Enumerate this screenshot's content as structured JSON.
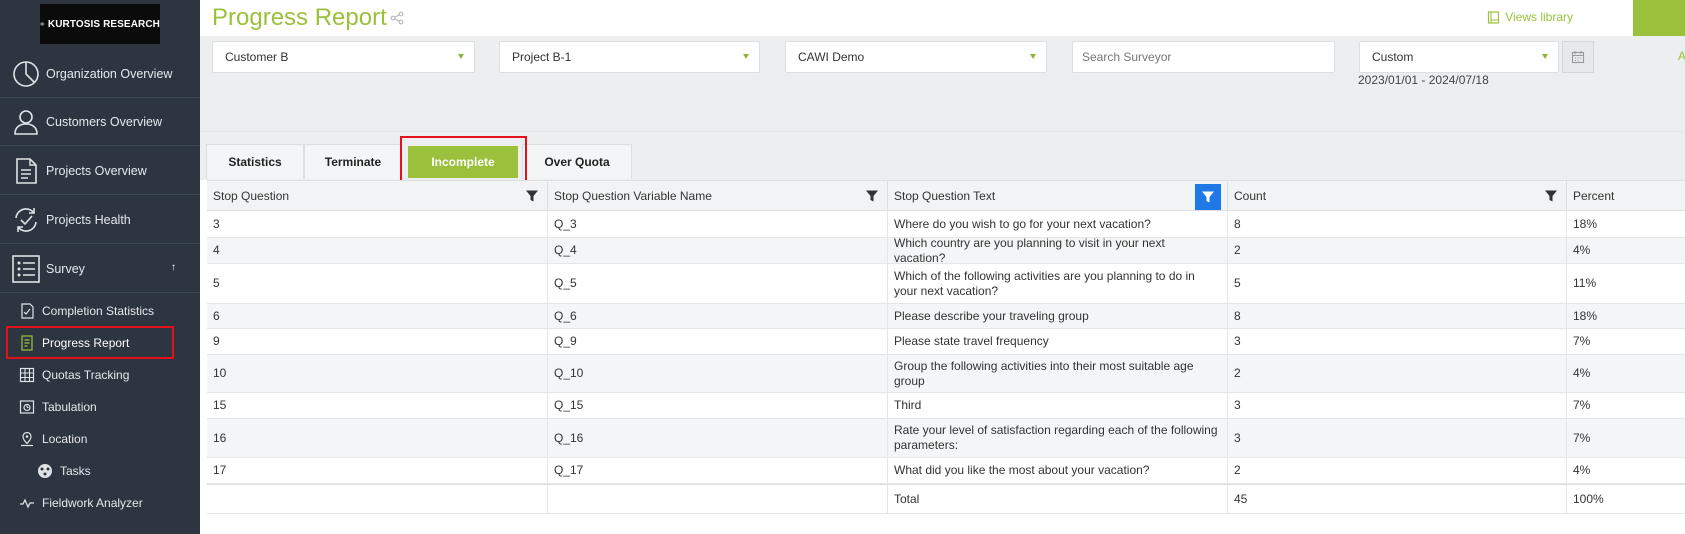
{
  "brand": {
    "logo_text": "KURTOSIS RESEARCH",
    "accent_color": "#9bc13c",
    "sidebar_bg": "#2c3540"
  },
  "sidebar": {
    "nav": [
      {
        "label": "Organization Overview",
        "icon": "pie-chart-icon"
      },
      {
        "label": "Customers Overview",
        "icon": "user-icon"
      },
      {
        "label": "Projects Overview",
        "icon": "document-icon"
      },
      {
        "label": "Projects Health",
        "icon": "refresh-check-icon"
      },
      {
        "label": "Survey",
        "icon": "list-icon"
      }
    ],
    "survey_collapse_arrow": "↑",
    "sub": [
      {
        "label": "Completion Statistics",
        "icon": "checklist-icon"
      },
      {
        "label": "Progress Report",
        "icon": "report-icon",
        "active": true
      },
      {
        "label": "Quotas Tracking",
        "icon": "grid-icon"
      },
      {
        "label": "Tabulation",
        "icon": "tabulation-icon"
      },
      {
        "label": "Location",
        "icon": "location-icon"
      },
      {
        "label": "Tasks",
        "icon": "tasks-icon"
      },
      {
        "label": "Fieldwork Analyzer",
        "icon": "pulse-icon"
      }
    ]
  },
  "header": {
    "title": "Progress Report",
    "views_library": "Views library"
  },
  "filters": {
    "customer": "Customer B",
    "project": "Project B-1",
    "survey": "CAWI Demo",
    "search_placeholder": "Search Surveyor",
    "period": "Custom",
    "date_range": "2023/01/01 - 2024/07/18",
    "apply_label": "A"
  },
  "tabs": [
    {
      "label": "Statistics"
    },
    {
      "label": "Terminate"
    },
    {
      "label": "Incomplete",
      "active": true
    },
    {
      "label": "Over Quota"
    }
  ],
  "table": {
    "columns": [
      "Stop Question",
      "Stop Question Variable Name",
      "Stop Question Text",
      "Count",
      "Percent"
    ],
    "active_filter_column": "Stop Question Text",
    "rows": [
      {
        "q": "3",
        "var": "Q_3",
        "text": "Where do you wish to go for your next vacation?",
        "count": "8",
        "pct": "18%"
      },
      {
        "q": "4",
        "var": "Q_4",
        "text": "Which country are you planning to visit in your next vacation?",
        "count": "2",
        "pct": "4%"
      },
      {
        "q": "5",
        "var": "Q_5",
        "text": "Which of the following activities are you planning to do in your next vacation?",
        "count": "5",
        "pct": "11%"
      },
      {
        "q": "6",
        "var": "Q_6",
        "text": "Please describe your traveling group",
        "count": "8",
        "pct": "18%"
      },
      {
        "q": "9",
        "var": "Q_9",
        "text": "Please state travel frequency",
        "count": "3",
        "pct": "7%"
      },
      {
        "q": "10",
        "var": "Q_10",
        "text": "Group the following activities into their most suitable age group",
        "count": "2",
        "pct": "4%"
      },
      {
        "q": "15",
        "var": "Q_15",
        "text": "Third",
        "count": "3",
        "pct": "7%"
      },
      {
        "q": "16",
        "var": "Q_16",
        "text": "Rate your level of satisfaction regarding each of the following parameters:",
        "count": "3",
        "pct": "7%"
      },
      {
        "q": "17",
        "var": "Q_17",
        "text": "What did you like the most about your vacation?",
        "count": "2",
        "pct": "4%"
      }
    ],
    "total": {
      "label": "Total",
      "count": "45",
      "pct": "100%"
    }
  }
}
